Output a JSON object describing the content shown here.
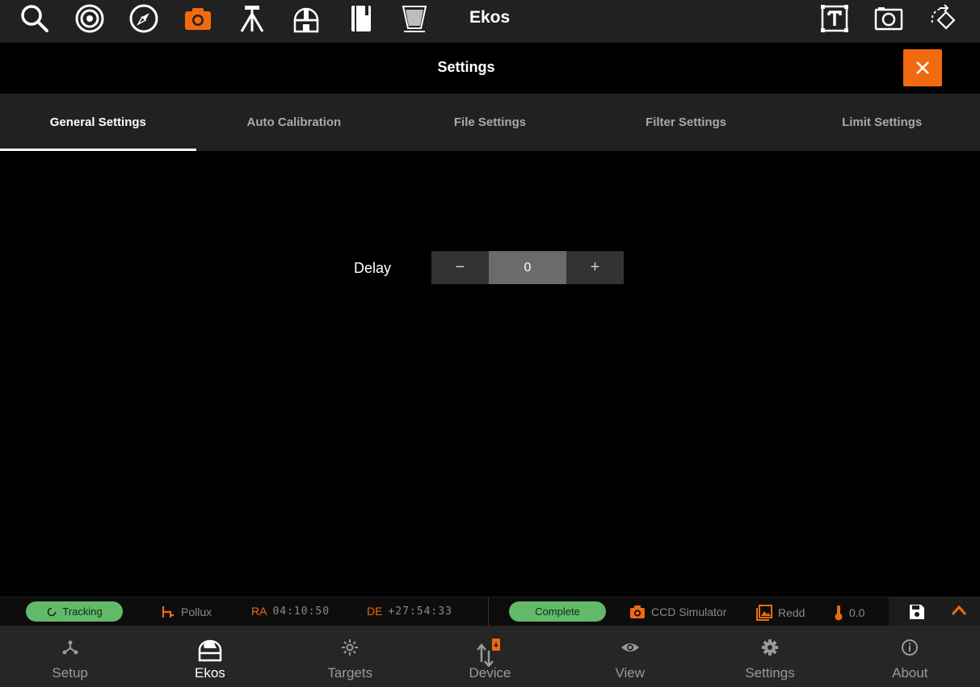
{
  "toolbar": {
    "title": "Ekos",
    "icons": [
      "search-icon",
      "target-icon",
      "compass-icon",
      "camera-icon",
      "tripod-icon",
      "observatory-icon",
      "notebook-icon",
      "filter-icon",
      "text-frame-icon",
      "image-frame-icon",
      "rotate-icon"
    ],
    "active_icon": "camera-icon"
  },
  "settings": {
    "title": "Settings",
    "close_icon": "close-icon"
  },
  "tabs": [
    "General Settings",
    "Auto Calibration",
    "File Settings",
    "Filter Settings",
    "Limit Settings"
  ],
  "active_tab": "General Settings",
  "general": {
    "delay_label": "Delay",
    "decrement": "−",
    "delay_value": "0",
    "increment": "+"
  },
  "status": {
    "tracking": "Tracking",
    "target": "Pollux",
    "ra_label": "RA",
    "ra_value": "04:10:50",
    "de_label": "DE",
    "de_value": "+27:54:33",
    "capture_state": "Complete",
    "camera": "CCD Simulator",
    "filter": "Redd",
    "temperature": "0.0"
  },
  "nav": {
    "items": [
      "Setup",
      "Ekos",
      "Targets",
      "Device",
      "View",
      "Settings",
      "About"
    ],
    "active": "Ekos"
  },
  "colors": {
    "accent": "#f26a0f",
    "pill_green": "#63b96a",
    "toolbar_bg": "#212121",
    "nav_bg": "#262626"
  }
}
